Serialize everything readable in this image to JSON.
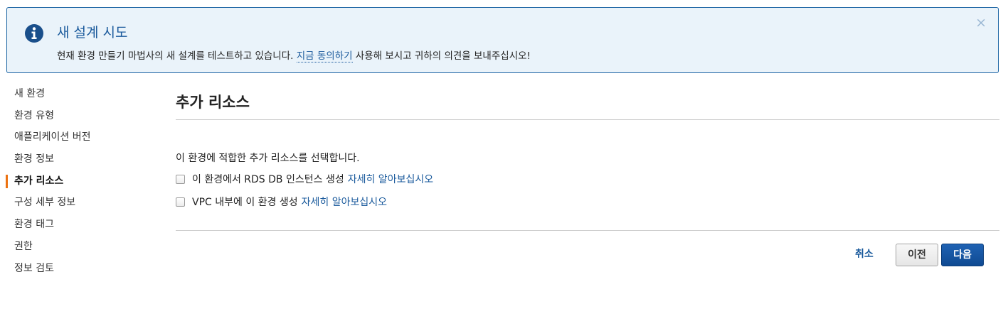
{
  "banner": {
    "icon": "info-circle-icon",
    "title": "새 설계 시도",
    "text_before": "현재 환경 만들기 마법사의 새 설계를 테스트하고 있습니다. ",
    "link": "지금 동의하기",
    "text_after": " 사용해 보시고 귀하의 의견을 보내주십시오!",
    "close_icon": "close-icon",
    "close_glyph": "×"
  },
  "sidebar": {
    "items": [
      {
        "label": "새 환경"
      },
      {
        "label": "환경 유형"
      },
      {
        "label": "애플리케이션 버전"
      },
      {
        "label": "환경 정보"
      },
      {
        "label": "추가 리소스",
        "active": true
      },
      {
        "label": "구성 세부 정보"
      },
      {
        "label": "환경 태그"
      },
      {
        "label": "권한"
      },
      {
        "label": "정보 검토"
      }
    ]
  },
  "main": {
    "title": "추가 리소스",
    "description": "이 환경에 적합한 추가 리소스를 선택합니다.",
    "options": [
      {
        "label": "이 환경에서 RDS DB 인스턴스 생성",
        "link": "자세히 알아보십시오",
        "checked": false
      },
      {
        "label": "VPC 내부에 이 환경 생성",
        "link": "자세히 알아보십시오",
        "checked": false
      }
    ]
  },
  "actions": {
    "cancel": "취소",
    "previous": "이전",
    "next": "다음"
  },
  "colors": {
    "accent": "#1a5a9c",
    "active_indicator": "#ec7211",
    "banner_background": "#eaf3fa",
    "primary_button": "#1f62b3"
  }
}
